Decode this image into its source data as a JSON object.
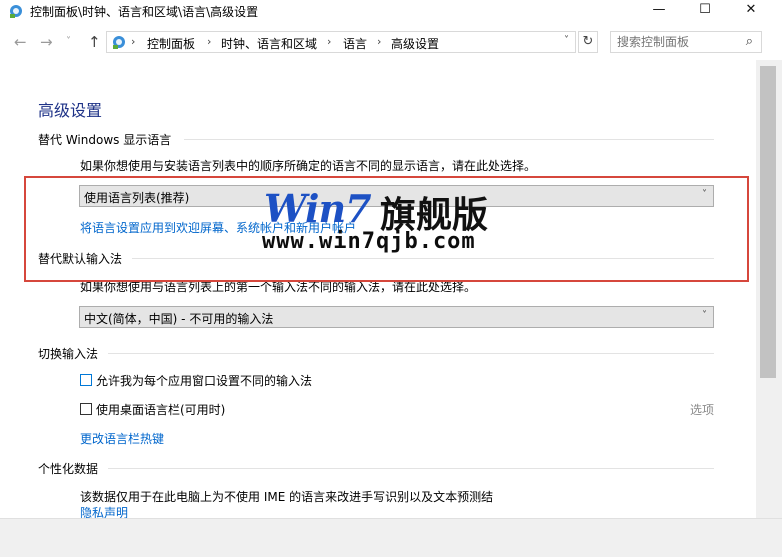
{
  "window": {
    "title": "控制面板\\时钟、语言和区域\\语言\\高级设置",
    "minimize_glyph": "—",
    "maximize_glyph": "☐",
    "close_glyph": "✕"
  },
  "nav": {
    "back_icon": "←",
    "forward_icon": "→",
    "history_icon": "˅",
    "up_icon": "↑"
  },
  "address": {
    "breadcrumbs": [
      "控制面板",
      "时钟、语言和区域",
      "语言",
      "高级设置"
    ],
    "separator": "›",
    "dropdown_icon": "˅",
    "refresh_icon": "↻"
  },
  "search": {
    "placeholder": "搜索控制面板",
    "icon": "⌕"
  },
  "page": {
    "title": "高级设置",
    "display_language": {
      "heading": "替代 Windows 显示语言",
      "description": "如果你想使用与安装语言列表中的顺序所确定的语言不同的显示语言，请在此处选择。",
      "selected": "使用语言列表(推荐)",
      "link": "将语言设置应用到欢迎屏幕、系统帐户和新用户帐户"
    },
    "default_input": {
      "heading": "替代默认输入法",
      "description": "如果你想使用与语言列表上的第一个输入法不同的输入法，请在此处选择。",
      "selected": "中文(简体，中国) - 不可用的输入法"
    },
    "switch_input": {
      "heading": "切换输入法",
      "option_per_app": "允许我为每个应用窗口设置不同的输入法",
      "option_language_bar": "使用桌面语言栏(可用时)",
      "options_link": "选项",
      "hotkeys_link": "更改语言栏热键"
    },
    "personalization": {
      "heading": "个性化数据",
      "description": "该数据仅用于在此电脑上为不使用 IME 的语言来改进手写识别以及文本预测结",
      "privacy_link": "隐私声明"
    }
  },
  "watermark": {
    "brand": "Win7",
    "brand_cn": "旗舰版",
    "url": "www.win7qjb.com"
  },
  "colors": {
    "title_blue": "#1e3287",
    "link_blue": "#0066cc",
    "highlight_red": "#d6473c"
  }
}
